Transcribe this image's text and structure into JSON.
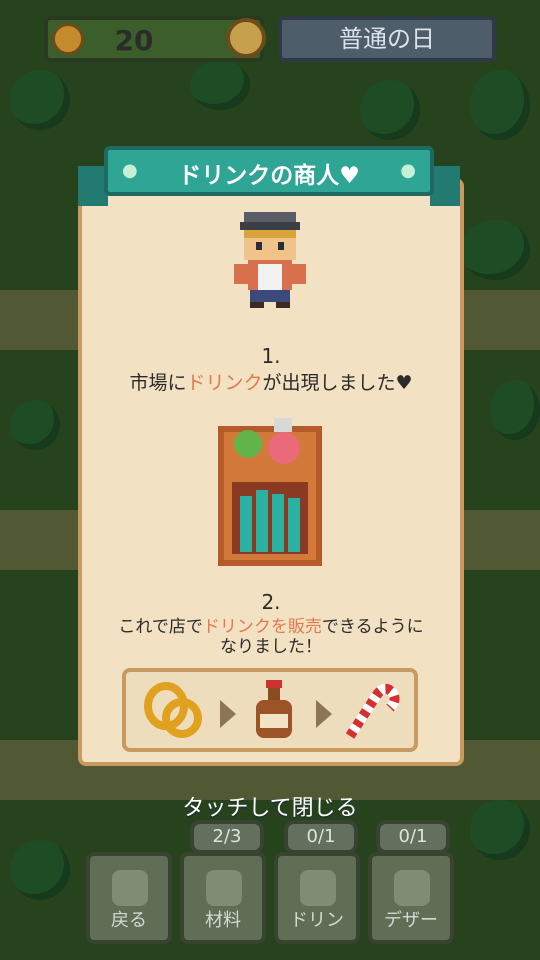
{
  "hud": {
    "coins": "20",
    "day_label": "普通の日"
  },
  "popup": {
    "title": "ドリンクの商人♥",
    "step1_number": "1.",
    "step1_pre": "市場に",
    "step1_highlight": "ドリンク",
    "step1_post": "が出現しました♥",
    "step2_number": "2.",
    "step2_line1_pre": "これで店で",
    "step2_line1_highlight": "ドリンクを販売",
    "step2_line1_post": "できるように",
    "step2_line2": "なりました！",
    "close_hint": "タッチして閉じる",
    "flow_icons": [
      "pretzel-icon",
      "drink-bottle-icon",
      "candy-cane-icon"
    ]
  },
  "tabs": [
    {
      "label": "戻る",
      "count": ""
    },
    {
      "label": "材料",
      "count": "2/3"
    },
    {
      "label": "ドリン",
      "count": "0/1"
    },
    {
      "label": "デザー",
      "count": "0/1"
    }
  ],
  "colors": {
    "banner": "#2fa596",
    "panel": "#f2e1c2",
    "highlight": "#e17a52"
  }
}
